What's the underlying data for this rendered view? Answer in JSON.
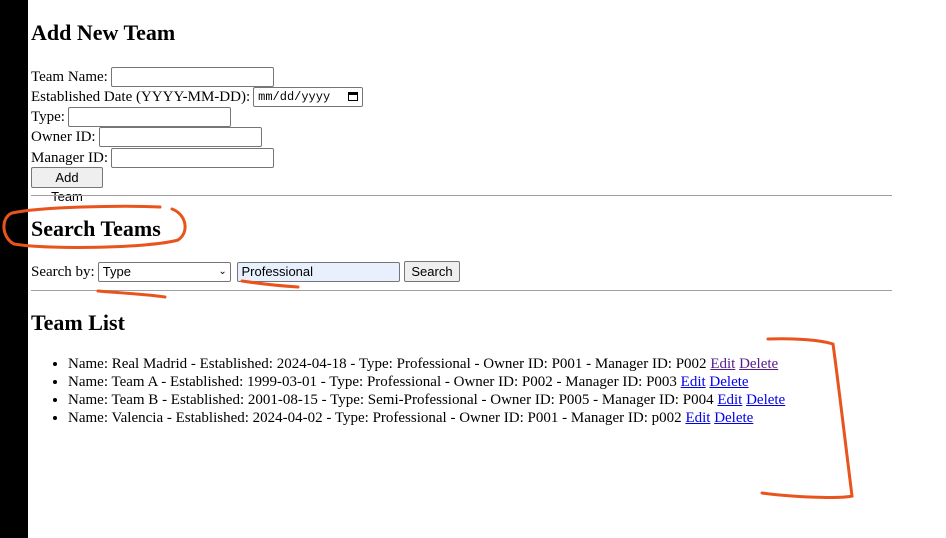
{
  "add_form": {
    "title": "Add New Team",
    "team_name_label": "Team Name:",
    "established_label": "Established Date (YYYY-MM-DD):",
    "date_placeholder": "mm/dd/yyyy",
    "type_label": "Type:",
    "owner_label": "Owner ID:",
    "manager_label": "Manager ID:",
    "submit_label": "Add Team"
  },
  "search": {
    "title": "Search Teams",
    "search_by_label": "Search by:",
    "selected_field": "Type",
    "query_value": "Professional",
    "button_label": "Search"
  },
  "list": {
    "title": "Team List",
    "edit_label": "Edit",
    "delete_label": "Delete",
    "items": [
      {
        "text": "Name: Real Madrid - Established: 2024-04-18 - Type: Professional - Owner ID: P001 - Manager ID: P002"
      },
      {
        "text": "Name: Team A - Established: 1999-03-01 - Type: Professional - Owner ID: P002 - Manager ID: P003"
      },
      {
        "text": "Name: Team B - Established: 2001-08-15 - Type: Semi-Professional - Owner ID: P005 - Manager ID: P004"
      },
      {
        "text": "Name: Valencia - Established: 2024-04-02 - Type: Professional - Owner ID: P001 - Manager ID: p002"
      }
    ]
  },
  "annotation_color": "#e8541c"
}
